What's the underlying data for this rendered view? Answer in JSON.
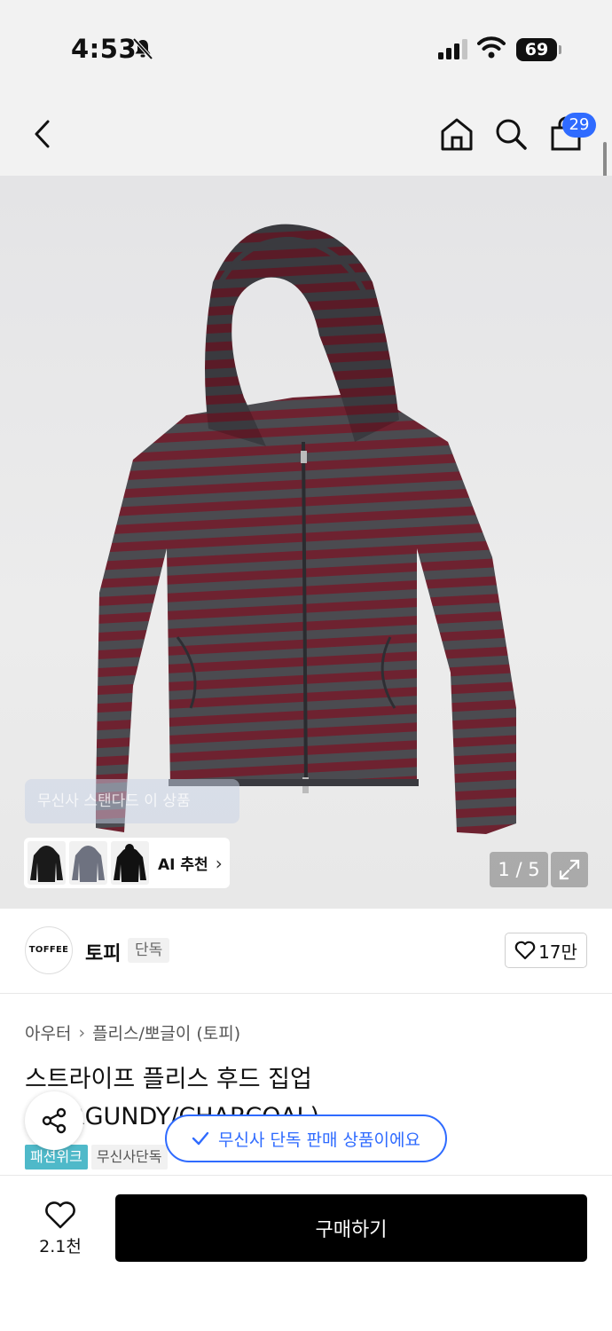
{
  "status": {
    "time": "4:53",
    "battery": "69"
  },
  "nav": {
    "cart_count": "29"
  },
  "gallery": {
    "faded_tag": "무신사 스탠다드 이 상품",
    "ai_label": "AI 추천",
    "counter": "1 / 5"
  },
  "brand": {
    "logo_text": "TOFFEE",
    "name": "토피",
    "badge": "단독",
    "likes": "17만"
  },
  "breadcrumb": [
    "아우터",
    "플리스/뽀글이 (토피)"
  ],
  "product": {
    "title": "스트라이프 플리스 후드 집업 (BURGUNDY/CHARCOAL)",
    "tags": [
      "패션위크",
      "무신사단독"
    ]
  },
  "toast": "무신사 단독 판매 상품이에요",
  "bottom": {
    "wish_count": "2.1천",
    "buy_label": "구매하기"
  },
  "colors": {
    "accent": "#2f6bff",
    "tag_teal": "#4fb9c9",
    "burgundy": "#6e2230",
    "charcoal": "#4b4b50"
  }
}
